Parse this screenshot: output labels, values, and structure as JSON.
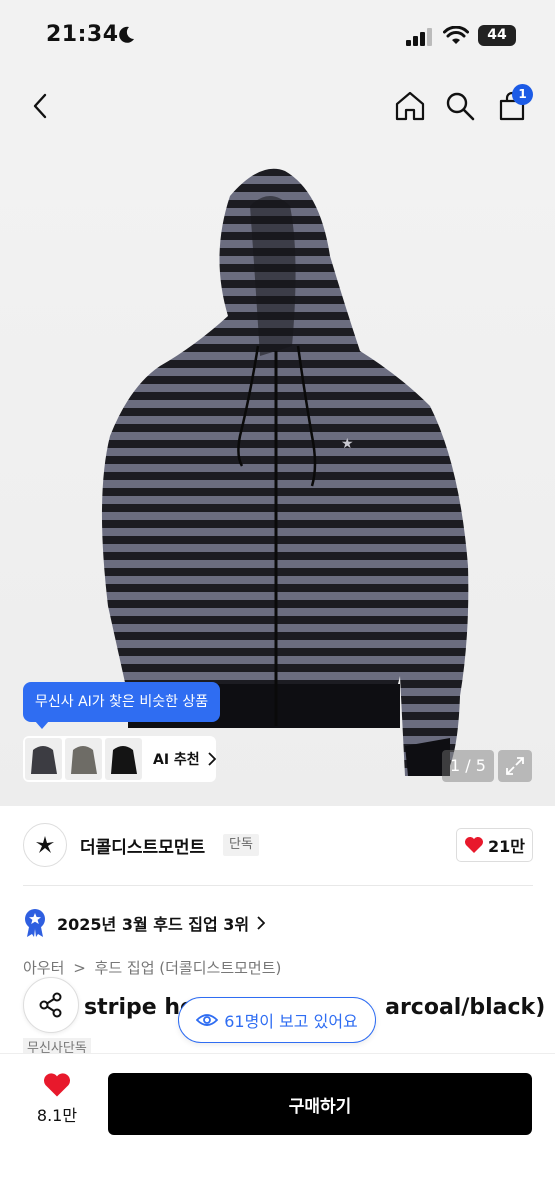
{
  "status_bar": {
    "time": "21:34",
    "battery": "44"
  },
  "top_nav": {
    "cart_count": "1"
  },
  "hero": {
    "ai_tooltip": "무신사 AI가 찾은 비슷한 상품",
    "ai_recommend_label": "AI 추천",
    "page_indicator": "1 / 5"
  },
  "brand": {
    "name": "더콜디스트모먼트",
    "tag": "단독",
    "like_count": "21만"
  },
  "rank": {
    "text": "2025년 3월 후드 집업 3위"
  },
  "breadcrumb": {
    "items": [
      "아우터",
      "후드 집업 (더콜디스트모먼트)"
    ],
    "separator": ">"
  },
  "product": {
    "title_left": "stripe ho",
    "title_right": "arcoal/black)",
    "exclusive_tag": "무신사단독"
  },
  "views_pill": {
    "text": "61명이 보고 있어요"
  },
  "bottom_bar": {
    "like_count": "8.1만",
    "buy_label": "구매하기"
  },
  "colors": {
    "accent": "#2f6df2",
    "heart": "#e8192c",
    "buy_button": "#000000",
    "cart_badge": "#1c5be6"
  }
}
